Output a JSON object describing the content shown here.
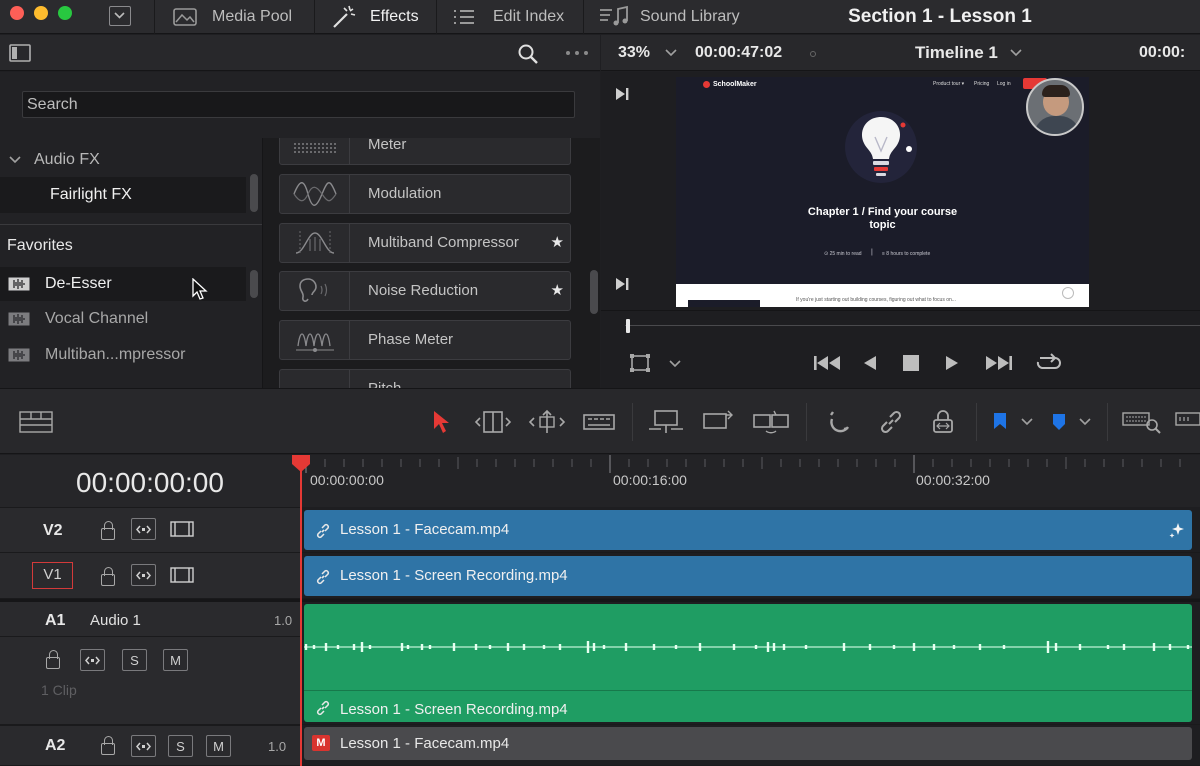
{
  "window": {
    "title": "Section 1 - Lesson 1"
  },
  "topbar": {
    "tabs": [
      {
        "label": "Media Pool"
      },
      {
        "label": "Effects"
      },
      {
        "label": "Edit Index"
      },
      {
        "label": "Sound Library"
      }
    ]
  },
  "effects": {
    "search_placeholder": "Search",
    "tree": {
      "audio_fx": "Audio FX",
      "fairlight_fx": "Fairlight FX",
      "favorites_heading": "Favorites",
      "favorites": [
        "De-Esser",
        "Vocal Channel",
        "Multiban...mpressor"
      ]
    },
    "fx_items": [
      {
        "label": "Meter",
        "favorite": false
      },
      {
        "label": "Modulation",
        "favorite": false
      },
      {
        "label": "Multiband Compressor",
        "favorite": true
      },
      {
        "label": "Noise Reduction",
        "favorite": true
      },
      {
        "label": "Phase Meter",
        "favorite": false
      },
      {
        "label": "Pitch",
        "favorite": false
      }
    ]
  },
  "viewer": {
    "zoom": "33%",
    "timecode": "00:00:47:02",
    "timeline_name": "Timeline 1",
    "timecode_right": "00:00:",
    "video": {
      "brand": "SchoolMaker",
      "nav_items": [
        "Product tour ▾",
        "Pricing",
        "Log in"
      ],
      "headline_line1": "Chapter 1 / Find your course",
      "headline_line2": "topic",
      "meta_left": "⊙ 25 min to read",
      "meta_right": "≡ 8 hours to complete",
      "body_text": "If you're just starting out building courses, figuring out what to focus on..."
    }
  },
  "timeline": {
    "timecode": "00:00:00:00",
    "ruler_labels": [
      "00:00:00:00",
      "00:00:16:00",
      "00:00:32:00"
    ],
    "tracks": {
      "v2": {
        "label": "V2",
        "clip": "Lesson 1 - Facecam.mp4"
      },
      "v1": {
        "label": "V1",
        "clip": "Lesson 1 - Screen Recording.mp4"
      },
      "a1": {
        "label": "A1",
        "name": "Audio 1",
        "volume": "1.0",
        "clip_count": "1 Clip",
        "clip": "Lesson 1 - Screen Recording.mp4"
      },
      "a2": {
        "label": "A2",
        "volume": "1.0",
        "clip": "Lesson 1 - Facecam.mp4",
        "clip_badge": "M"
      }
    },
    "buttons": {
      "solo": "S",
      "mute": "M"
    }
  },
  "colors": {
    "video_clip": "#2f74a6",
    "audio_clip": "#1f9d63",
    "playhead": "#e53935",
    "accent_blue": "#1e74e6"
  }
}
